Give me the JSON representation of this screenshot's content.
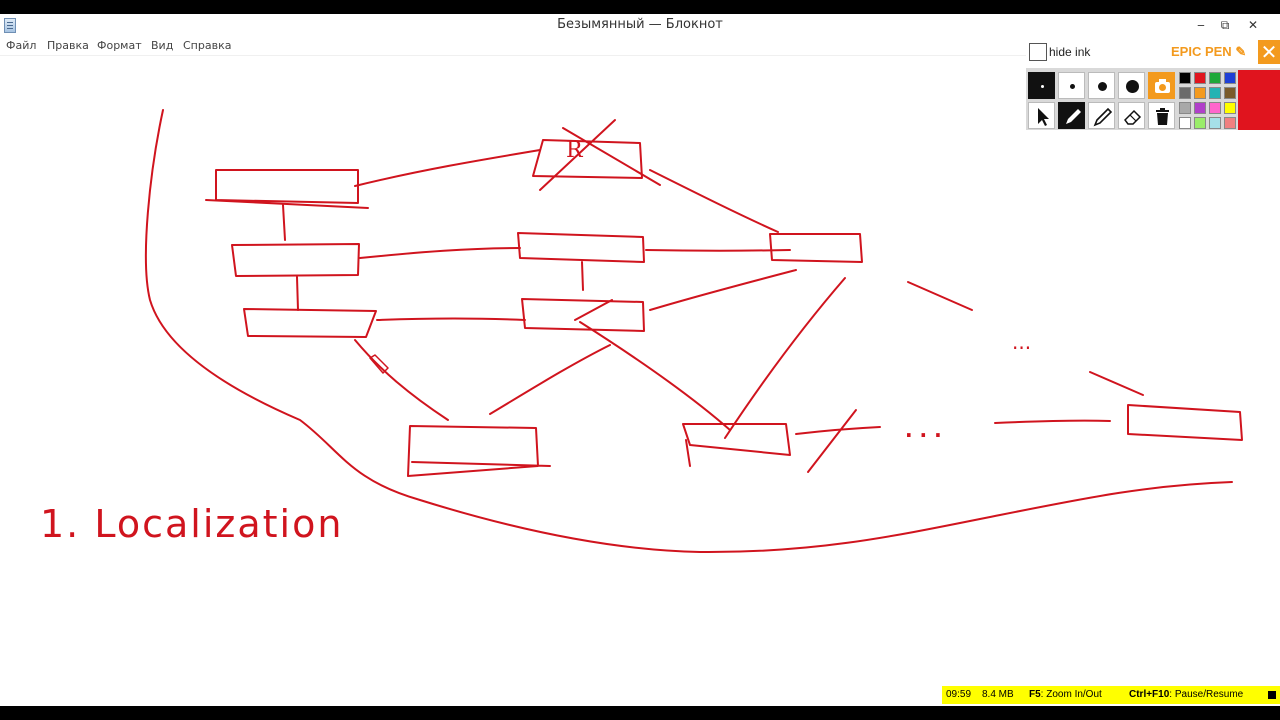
{
  "window": {
    "title": "Безымянный — Блокнот",
    "min_glyph": "‒",
    "max_glyph": "⧉",
    "close_glyph": "✕"
  },
  "menu": {
    "items": [
      "Файл",
      "Правка",
      "Формат",
      "Вид",
      "Справка"
    ]
  },
  "drawing": {
    "ink_color": "#d0141e",
    "node_label": "R",
    "ellipsis_1": "...",
    "ellipsis_2": ". . .",
    "heading": "1. Localization"
  },
  "epic_pen": {
    "hide_ink_label": "hide ink",
    "brand": "EPIC PEN",
    "close_glyph": "✕",
    "selected_color": "#e0141e",
    "tools": [
      "pen-size-small",
      "pen-size-medium",
      "pen-size-large",
      "pen-size-xlarge",
      "screenshot",
      "pointer",
      "pen",
      "highlighter",
      "eraser",
      "clear-all"
    ],
    "palette": [
      "#000000",
      "#e0141e",
      "#1fa83a",
      "#1f3fd6",
      "#6b6b6b",
      "#f39a1e",
      "#23b3b3",
      "#7a5a2a",
      "#a8a8a8",
      "#b03fc9",
      "#ff66cc",
      "#ffff00",
      "#ffffff",
      "#9aeb6a",
      "#a6e0e8",
      "#f08080"
    ]
  },
  "status": {
    "time": "09:59",
    "size": "8.4 MB",
    "zoom_key": "F5",
    "zoom_label": ": Zoom In/Out",
    "pause_key": "Ctrl+F10",
    "pause_label": ": Pause/Resume"
  }
}
